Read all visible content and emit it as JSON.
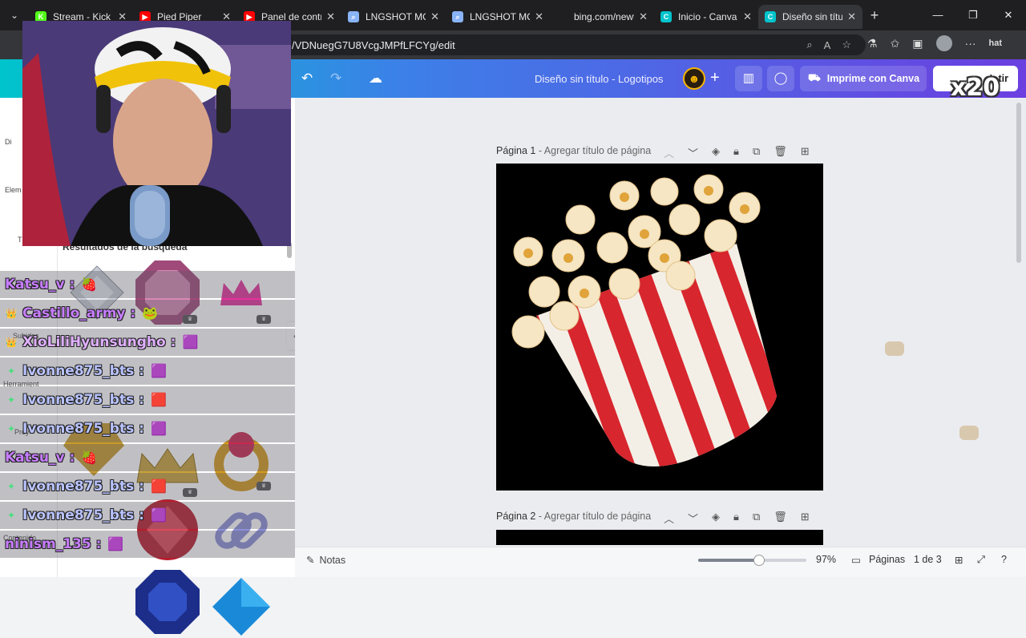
{
  "browser": {
    "tabs": [
      {
        "title": "Stream - Kick D",
        "icon": "kick-icon",
        "color": "#53fc18",
        "active": false
      },
      {
        "title": "Pied Piper",
        "icon": "youtube-icon",
        "color": "#ff0000",
        "active": false
      },
      {
        "title": "Panel de contro",
        "icon": "youtube-icon",
        "color": "#ff0000",
        "active": false
      },
      {
        "title": "LNGSHOT MOC",
        "icon": "search-icon",
        "color": "#8ab4f8",
        "active": false
      },
      {
        "title": "LNGSHOT MOC",
        "icon": "search-icon",
        "color": "#8ab4f8",
        "active": false
      },
      {
        "title": "bing.com/newt",
        "icon": "blank-icon",
        "color": "#1f1f22",
        "active": false
      },
      {
        "title": "Inicio - Canva",
        "icon": "canva-icon",
        "color": "#00c4cc",
        "active": false
      },
      {
        "title": "Diseño sin títul",
        "icon": "canva-icon",
        "color": "#00c4cc",
        "active": true
      }
    ],
    "url": "/VDNuegG7U8VcgJMPfLFCYg/edit",
    "profile_label": "hat"
  },
  "canva": {
    "doc_title": "Diseño sin título - Logotipos",
    "print_label": "Imprime con Canva",
    "share_label": "L       tir",
    "overlay_badge": "x20",
    "results_title": "Resultados de la búsqueda",
    "rail_labels": [
      "Di",
      "Elem",
      "T",
      "Subidos",
      "Herramient",
      "Proy",
      "Contenido"
    ],
    "pages": [
      {
        "label": "Página 1",
        "subtitle": " - Agregar título de página"
      },
      {
        "label": "Página 2",
        "subtitle": " - Agregar título de página"
      }
    ],
    "footer": {
      "notes": "Notas",
      "zoom": "97%",
      "zoom_fraction": 0.56,
      "pages_label": "Páginas",
      "page_count": "1 de 3"
    }
  },
  "chat": [
    {
      "name": "Katsu_v :",
      "color": "#c77dff",
      "badge": "",
      "emote": "🍓"
    },
    {
      "name": "Castillo_army :",
      "color": "#c77dff",
      "badge": "👑",
      "emote": "🐸"
    },
    {
      "name": "XioLiliHyunsungho :",
      "color": "#e0b0ff",
      "badge": "👑",
      "emote": "🟪"
    },
    {
      "name": "Ivonne875_bts :",
      "color": "#b9c3ff",
      "badge": "✦",
      "emote": "🟪"
    },
    {
      "name": "Ivonne875_bts :",
      "color": "#b9c3ff",
      "badge": "✦",
      "emote": "🟥"
    },
    {
      "name": "Ivonne875_bts :",
      "color": "#b9c3ff",
      "badge": "✦",
      "emote": "🟪"
    },
    {
      "name": "Katsu_v :",
      "color": "#c77dff",
      "badge": "",
      "emote": "🍓"
    },
    {
      "name": "Ivonne875_bts :",
      "color": "#b9c3ff",
      "badge": "✦",
      "emote": "🟥"
    },
    {
      "name": "Ivonne875_bts :",
      "color": "#b9c3ff",
      "badge": "✦",
      "emote": "🟪"
    },
    {
      "name": "ninism_135 :",
      "color": "#c77dff",
      "badge": "",
      "emote": "🟪"
    }
  ]
}
